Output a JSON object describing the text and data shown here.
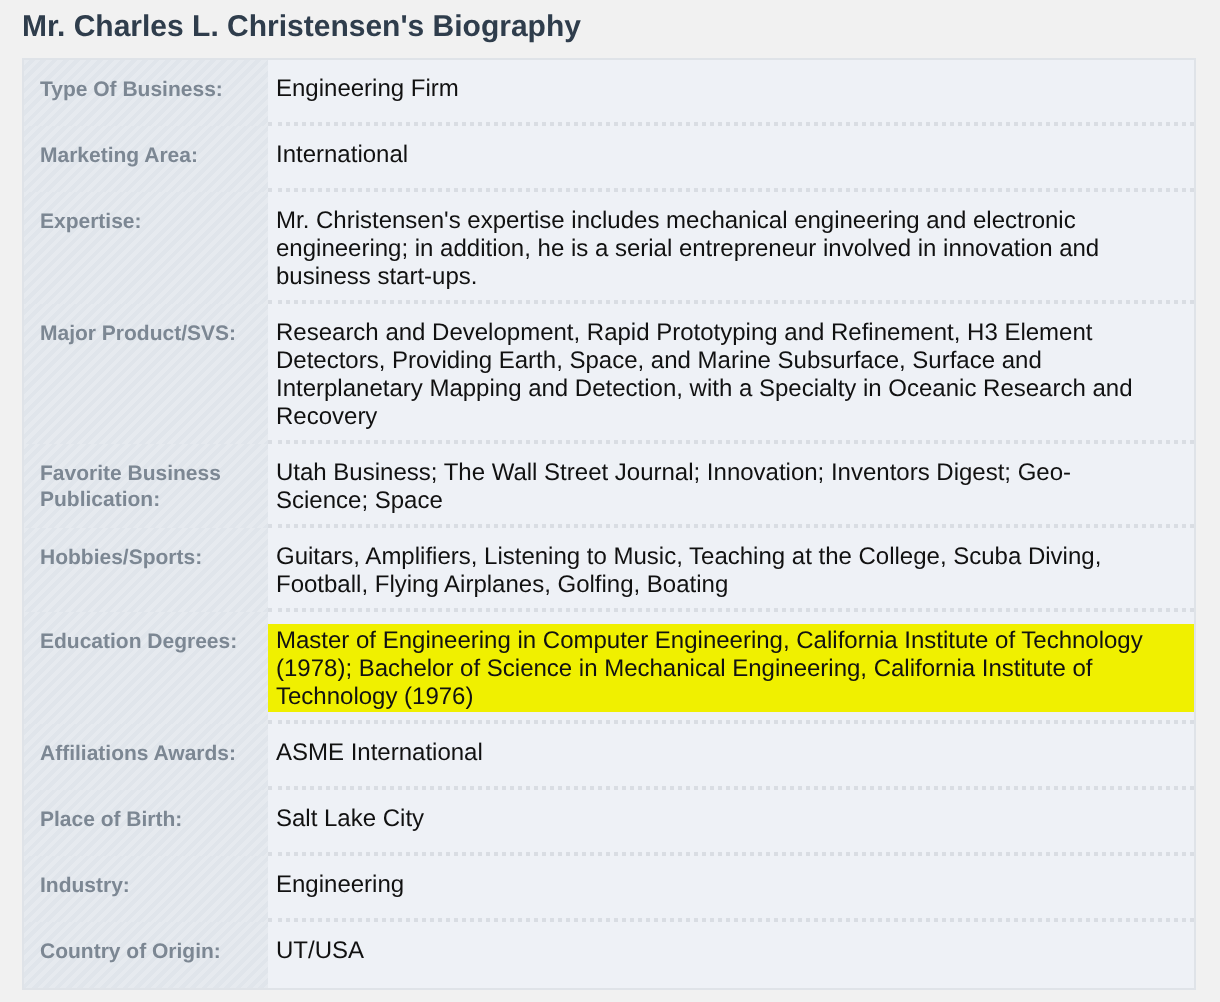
{
  "title": "Mr. Charles L. Christensen's Biography",
  "rows": [
    {
      "label": "Type Of Business:",
      "value": "Engineering Firm",
      "highlighted": false
    },
    {
      "label": "Marketing Area:",
      "value": "International",
      "highlighted": false
    },
    {
      "label": "Expertise:",
      "value": "Mr. Christensen's expertise includes mechanical engineering and electronic engineering; in addition, he is a serial entrepreneur involved in innovation and business start-ups.",
      "highlighted": false
    },
    {
      "label": "Major Product/SVS:",
      "value": "Research and Development, Rapid Prototyping and Refinement, H3 Element Detectors, Providing Earth, Space, and Marine Subsurface, Surface and Interplanetary Mapping and Detection, with a Specialty in Oceanic Research and Recovery",
      "highlighted": false
    },
    {
      "label": "Favorite Business Publication:",
      "value": "Utah Business; The Wall Street Journal; Innovation; Inventors Digest; Geo-Science; Space",
      "highlighted": false
    },
    {
      "label": "Hobbies/Sports:",
      "value": "Guitars, Amplifiers, Listening to Music, Teaching at the College, Scuba Diving, Football, Flying Airplanes, Golfing, Boating",
      "highlighted": false
    },
    {
      "label": "Education Degrees:",
      "value": "Master of Engineering in Computer Engineering, California Institute of Technology (1978); Bachelor of Science in Mechanical Engineering, California Institute of Technology (1976)",
      "highlighted": true
    },
    {
      "label": "Affiliations Awards:",
      "value": "ASME International",
      "highlighted": false
    },
    {
      "label": "Place of Birth:",
      "value": "Salt Lake City",
      "highlighted": false
    },
    {
      "label": "Industry:",
      "value": "Engineering",
      "highlighted": false
    },
    {
      "label": "Country of Origin:",
      "value": "UT/USA",
      "highlighted": false
    }
  ]
}
